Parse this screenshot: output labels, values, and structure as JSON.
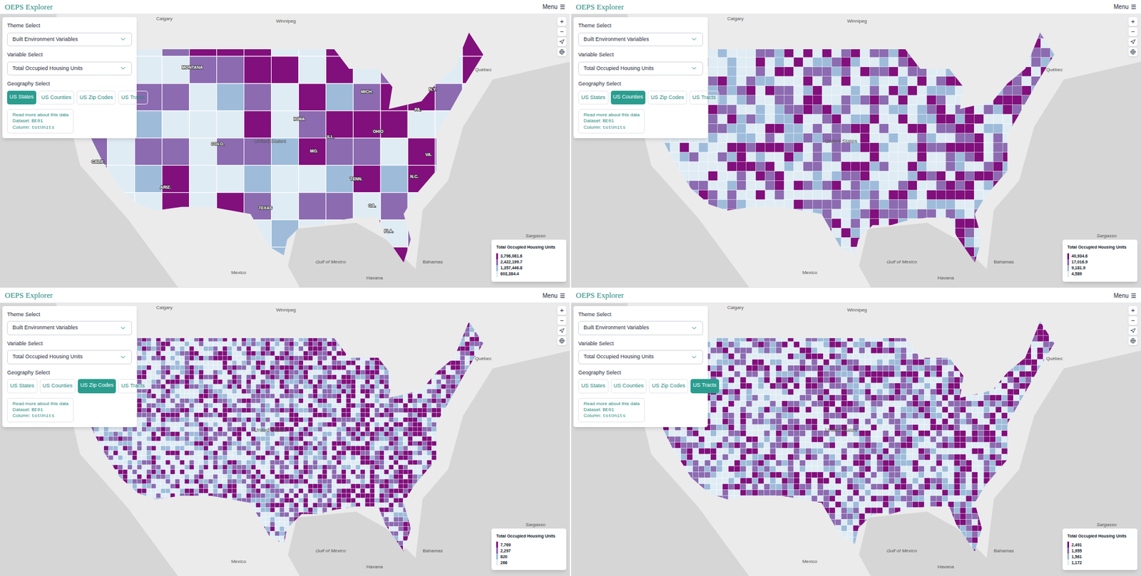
{
  "map_labels": [
    "Calgary",
    "Winnipeg",
    "Québec",
    "United States",
    "Gulf of Mexico",
    "Mexico",
    "Sargasso",
    "Bahamas",
    "Havana"
  ],
  "panels": [
    {
      "app_title": "OEPS Explorer",
      "menu": {
        "label": "Menu",
        "icon": "☰"
      },
      "theme": {
        "label": "Theme Select",
        "value": "Built Environment Variables"
      },
      "variable": {
        "label": "Variable Select",
        "value": "Total Occupied Housing Units"
      },
      "geography": {
        "label": "Geography Select",
        "options": [
          {
            "label": "US States",
            "selected": true
          },
          {
            "label": "US Counties",
            "selected": false
          },
          {
            "label": "US Zip Codes",
            "selected": false
          },
          {
            "label": "US Tracts",
            "selected": false
          }
        ]
      },
      "info": {
        "link": "Read more about this data",
        "dataset_label": "Dataset:",
        "dataset": "BE01",
        "column_label": "Column:",
        "column": "totUnits"
      },
      "zoom": [
        "+",
        "−"
      ],
      "legend": {
        "title": "Total Occupied Housing Units",
        "items": [
          {
            "label": "3,796,081.6",
            "color": "#810f7c"
          },
          {
            "label": "2,422,199.7",
            "color": "#8c6bb1"
          },
          {
            "label": "1,357,446.8",
            "color": "#9ebcda"
          },
          {
            "label": "603,384.4",
            "color": "#e0ecf4"
          }
        ]
      },
      "region_labels": [
        "MONTANA",
        "CALIF.",
        "TEXAS",
        "FLA.",
        "N.Y.",
        "PA.",
        "OHIO",
        "ILL.",
        "MICH.",
        "COLO.",
        "ARIZ.",
        "GA.",
        "N.C.",
        "VA.",
        "MO.",
        "IOWA",
        "TENN."
      ]
    },
    {
      "app_title": "OEPS Explorer",
      "menu": {
        "label": "Menu",
        "icon": "☰"
      },
      "theme": {
        "label": "Theme Select",
        "value": "Built Environment Variables"
      },
      "variable": {
        "label": "Variable Select",
        "value": "Total Occupied Housing Units"
      },
      "geography": {
        "label": "Geography Select",
        "options": [
          {
            "label": "US States",
            "selected": false
          },
          {
            "label": "US Counties",
            "selected": true
          },
          {
            "label": "US Zip Codes",
            "selected": false
          },
          {
            "label": "US Tracts",
            "selected": false
          }
        ]
      },
      "info": {
        "link": "Read more about this data",
        "dataset_label": "Dataset:",
        "dataset": "BE01",
        "column_label": "Column:",
        "column": "totUnits"
      },
      "zoom": [
        "+",
        "−"
      ],
      "legend": {
        "title": "Total Occupied Housing Units",
        "items": [
          {
            "label": "40,934.6",
            "color": "#810f7c"
          },
          {
            "label": "17,016.9",
            "color": "#8c6bb1"
          },
          {
            "label": "9,181.9",
            "color": "#9ebcda"
          },
          {
            "label": "4,589",
            "color": "#e0ecf4"
          }
        ]
      },
      "region_labels": []
    },
    {
      "app_title": "OEPS Explorer",
      "menu": {
        "label": "Menu",
        "icon": "☰"
      },
      "theme": {
        "label": "Theme Select",
        "value": "Built Environment Variables"
      },
      "variable": {
        "label": "Variable Select",
        "value": "Total Occupied Housing Units"
      },
      "geography": {
        "label": "Geography Select",
        "options": [
          {
            "label": "US States",
            "selected": false
          },
          {
            "label": "US Counties",
            "selected": false
          },
          {
            "label": "US Zip Codes",
            "selected": true
          },
          {
            "label": "US Tracts",
            "selected": false
          }
        ]
      },
      "info": {
        "link": "Read more about this data",
        "dataset_label": "Dataset:",
        "dataset": "BE01",
        "column_label": "Column:",
        "column": "totUnits"
      },
      "zoom": [
        "+",
        "−"
      ],
      "legend": {
        "title": "Total Occupied Housing Units",
        "items": [
          {
            "label": "7,769",
            "color": "#810f7c"
          },
          {
            "label": "2,297",
            "color": "#8c6bb1"
          },
          {
            "label": "820",
            "color": "#9ebcda"
          },
          {
            "label": "266",
            "color": "#e0ecf4"
          }
        ]
      },
      "region_labels": []
    },
    {
      "app_title": "OEPS Explorer",
      "menu": {
        "label": "Menu",
        "icon": "☰"
      },
      "theme": {
        "label": "Theme Select",
        "value": "Built Environment Variables"
      },
      "variable": {
        "label": "Variable Select",
        "value": "Total Occupied Housing Units"
      },
      "geography": {
        "label": "Geography Select",
        "options": [
          {
            "label": "US States",
            "selected": false
          },
          {
            "label": "US Counties",
            "selected": false
          },
          {
            "label": "US Zip Codes",
            "selected": false
          },
          {
            "label": "US Tracts",
            "selected": true
          }
        ]
      },
      "info": {
        "link": "Read more about this data",
        "dataset_label": "Dataset:",
        "dataset": "BE01",
        "column_label": "Column:",
        "column": "totUnits"
      },
      "zoom": [
        "+",
        "−"
      ],
      "legend": {
        "title": "Total Occupied Housing Units",
        "items": [
          {
            "label": "2,491",
            "color": "#810f7c"
          },
          {
            "label": "1,955",
            "color": "#8c6bb1"
          },
          {
            "label": "1,561",
            "color": "#9ebcda"
          },
          {
            "label": "1,172",
            "color": "#e0ecf4"
          }
        ]
      },
      "region_labels": []
    }
  ]
}
